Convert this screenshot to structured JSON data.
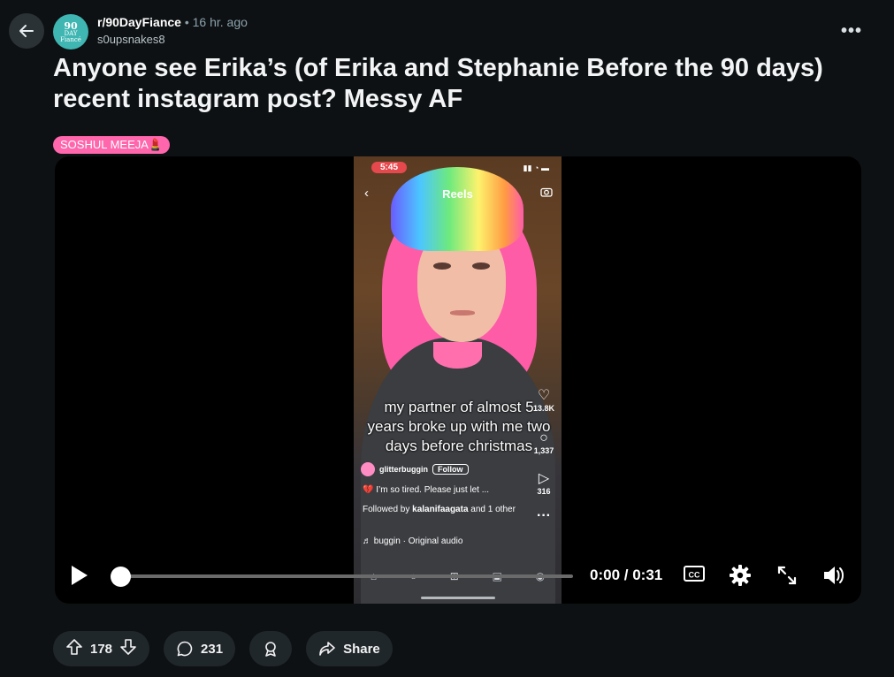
{
  "header": {
    "subreddit": "r/90DayFiance",
    "separator": "•",
    "posted_ago": "16 hr. ago",
    "author": "s0upsnakes8",
    "avatar_text_big": "90",
    "avatar_text_mid": "DAY",
    "avatar_text_small": "Fiancé"
  },
  "post": {
    "title": "Anyone see Erika’s (of Erika and Stephanie Before the 90 days) recent instagram post? Messy AF",
    "flair": "SOSHUL MEEJA💄"
  },
  "embedded_reel": {
    "clock": "5:45",
    "header_title": "Reels",
    "caption": "my partner of almost 5 years broke up with me two days before christmas",
    "likes": "13.8K",
    "comments": "1,337",
    "shares": "316",
    "username": "glitterbuggin",
    "follow_label": "Follow",
    "post_text": "💔 I’m so tired. Please just let ...",
    "followed_by_prefix": "Followed by",
    "followed_by_user": "kalanifaagata",
    "followed_by_suffix": "and 1 other",
    "audio": "♬ buggin · Original audio"
  },
  "video_controls": {
    "current_time": "0:00",
    "duration": "0:31",
    "time_separator": " / ",
    "progress": 0,
    "cc_label": "CC"
  },
  "actions": {
    "upvotes": "178",
    "comments": "231",
    "share_label": "Share"
  },
  "colors": {
    "background": "#0e1113",
    "flair_bg": "#ff66ac",
    "pill_bg": "#20272b",
    "subreddit_avatar": "#3fb6b2"
  }
}
